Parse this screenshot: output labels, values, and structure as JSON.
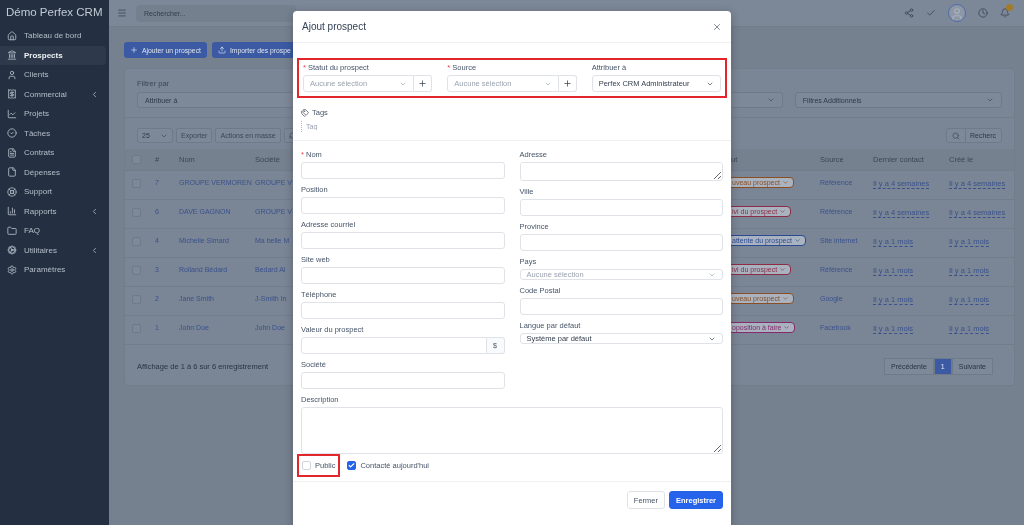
{
  "sidebar": {
    "brand": "Démo Perfex CRM",
    "items": [
      {
        "label": "Tableau de bord",
        "selected": false,
        "expandable": false
      },
      {
        "label": "Prospects",
        "selected": true,
        "expandable": false
      },
      {
        "label": "Clients",
        "selected": false,
        "expandable": false
      },
      {
        "label": "Commercial",
        "selected": false,
        "expandable": true
      },
      {
        "label": "Projets",
        "selected": false,
        "expandable": false
      },
      {
        "label": "Tâches",
        "selected": false,
        "expandable": false
      },
      {
        "label": "Contrats",
        "selected": false,
        "expandable": false
      },
      {
        "label": "Dépenses",
        "selected": false,
        "expandable": false
      },
      {
        "label": "Support",
        "selected": false,
        "expandable": false
      },
      {
        "label": "Rapports",
        "selected": false,
        "expandable": true
      },
      {
        "label": "FAQ",
        "selected": false,
        "expandable": false
      },
      {
        "label": "Utilitaires",
        "selected": false,
        "expandable": true
      },
      {
        "label": "Paramètres",
        "selected": false,
        "expandable": false
      }
    ]
  },
  "header": {
    "search_placeholder": "Rechercher..."
  },
  "page": {
    "buttons": [
      {
        "label": "Ajouter un prospect",
        "kind": "add"
      },
      {
        "label": "Importer des prospe",
        "kind": "import"
      }
    ],
    "filter": {
      "title": "Filtrer par",
      "selects": [
        "Attribuer à",
        "Filtres Additionnels"
      ]
    },
    "toolbar": {
      "page_length": "25",
      "buttons": [
        "Exporter",
        "Actions en masse"
      ],
      "search_placeholder": "Recherc"
    },
    "table": {
      "select_all_checked": false,
      "columns": [
        "#",
        "Nom",
        "Société",
        "ut",
        "Source",
        "Dernier contact",
        "Créé le"
      ],
      "rows": [
        {
          "checked": false,
          "id": "7",
          "name": "GROUPE VERMOREN",
          "company": "GROUPE V",
          "status": "uveau prospect",
          "color": "#8a4e22",
          "source": "Référence",
          "last_contact": "Il y a 4 semaines",
          "created": "Il y a 4 semaines"
        },
        {
          "checked": false,
          "id": "6",
          "name": "DAVE GAGNON",
          "company": "GROUPE V",
          "status": "ivi du prospect",
          "color": "#8c2c45",
          "source": "Référence",
          "last_contact": "Il y a 4 semaines",
          "created": "Il y a 4 semaines"
        },
        {
          "checked": false,
          "id": "4",
          "name": "Michelle Simard",
          "company": "Ma belle M",
          "status": "attente du prospect",
          "color": "#2c4a94",
          "source": "Site internet",
          "last_contact": "Il y a 1 mois",
          "created": "Il y a 1 mois"
        },
        {
          "checked": false,
          "id": "3",
          "name": "Rolland Bédard",
          "company": "Bedard Al",
          "status": "ivi du prospect",
          "color": "#8c2c45",
          "source": "Référence",
          "last_contact": "Il y a 1 mois",
          "created": "Il y a 1 mois"
        },
        {
          "checked": false,
          "id": "2",
          "name": "Jane Smith",
          "company": "J-Smith In",
          "status": "uveau prospect",
          "color": "#8a4e22",
          "source": "Google",
          "last_contact": "Il y a 1 mois",
          "created": "Il y a 1 mois"
        },
        {
          "checked": false,
          "id": "1",
          "name": "John Doe",
          "company": "John Doe",
          "status": "oposition à faire",
          "color": "#862a6c",
          "source": "Facebook",
          "last_contact": "Il y a 1 mois",
          "created": "Il y a 1 mois"
        }
      ]
    },
    "info": "Affichage de 1 à 6 sur 6 enregistrement",
    "pagination": [
      {
        "label": "Précédente",
        "selected": false
      },
      {
        "label": "1",
        "selected": true
      },
      {
        "label": "Suivante",
        "selected": false
      }
    ]
  },
  "modal": {
    "title": "Ajout prospect",
    "required_mark": "*",
    "top_fields": {
      "highlighted": true,
      "fields": [
        {
          "label": "Statut du prospect",
          "required": true,
          "kind": "select_add",
          "placeholder": "Aucune sélection"
        },
        {
          "label": "Source",
          "required": true,
          "kind": "select_add",
          "placeholder": "Aucune sélection"
        },
        {
          "label": "Attribuer à",
          "required": false,
          "kind": "select",
          "value": "Perfex CRM Administrateur"
        }
      ]
    },
    "tags": {
      "label": "Tags",
      "placeholder": "Tag"
    },
    "left_fields": [
      {
        "label": "Nom",
        "required": true,
        "kind": "input"
      },
      {
        "label": "Position",
        "required": false,
        "kind": "input"
      },
      {
        "label": "Adresse courriel",
        "required": false,
        "kind": "input"
      },
      {
        "label": "Site web",
        "required": false,
        "kind": "input"
      },
      {
        "label": "Téléphone",
        "required": false,
        "kind": "input"
      },
      {
        "label": "Valeur du prospect",
        "required": false,
        "kind": "addon",
        "addon": "$"
      },
      {
        "label": "Société",
        "required": false,
        "kind": "input"
      }
    ],
    "right_fields": [
      {
        "label": "Adresse",
        "required": false,
        "kind": "textarea"
      },
      {
        "label": "Ville",
        "required": false,
        "kind": "input"
      },
      {
        "label": "Province",
        "required": false,
        "kind": "input"
      },
      {
        "label": "Pays",
        "required": false,
        "kind": "select",
        "placeholder": "Aucune sélection"
      },
      {
        "label": "Code Postal",
        "required": false,
        "kind": "input"
      },
      {
        "label": "Langue par défaut",
        "required": false,
        "kind": "select",
        "value": "Système par défaut"
      }
    ],
    "description": {
      "label": "Description"
    },
    "checkboxes": [
      {
        "label": "Public",
        "checked": false,
        "highlighted": true
      },
      {
        "label": "Contacté aujourd'hui",
        "checked": true,
        "highlighted": false
      }
    ],
    "buttons": [
      {
        "label": "Fermer",
        "kind": "secondary"
      },
      {
        "label": "Enregistrer",
        "kind": "primary"
      }
    ]
  }
}
